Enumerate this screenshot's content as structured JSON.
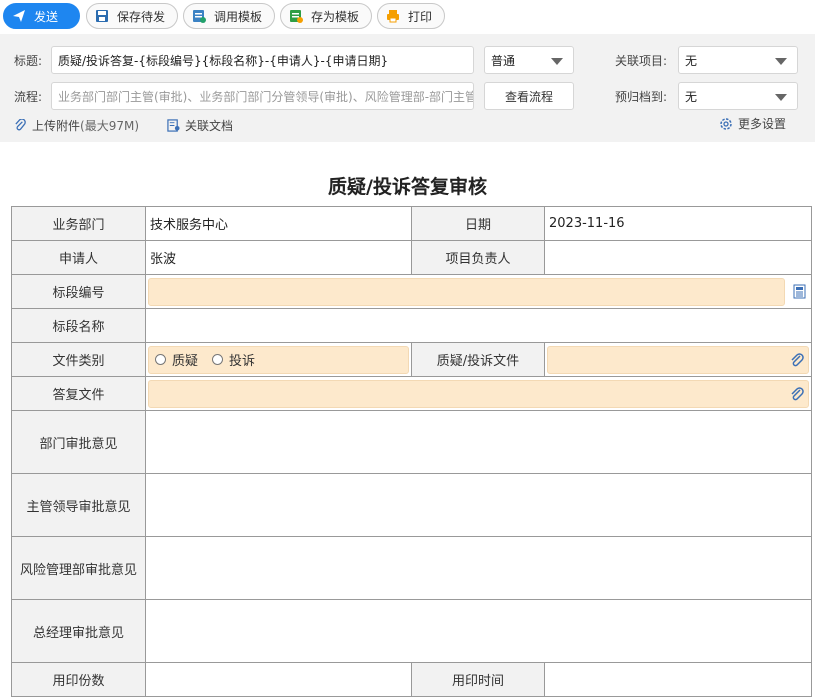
{
  "toolbar": {
    "send_label": "发送",
    "save_label": "保存待发",
    "template_label": "调用模板",
    "save_template_label": "存为模板",
    "print_label": "打印"
  },
  "header": {
    "title_label": "标题:",
    "title_value": "质疑/投诉答复-{标段编号}{标段名称}-{申请人}-{申请日期}",
    "priority_value": "普通",
    "related_project_label": "关联项目:",
    "related_project_value": "无",
    "flow_label": "流程:",
    "flow_value": "业务部门部门主管(审批)、业务部门部门分管领导(审批)、风险管理部-部门主管",
    "view_flow_label": "查看流程",
    "archive_label": "预归档到:",
    "archive_value": "无",
    "upload_label": "上传附件",
    "upload_limit": "(最大97M)",
    "related_doc_label": "关联文档",
    "more_settings_label": "更多设置"
  },
  "form": {
    "title": "质疑/投诉答复审核",
    "dept_label": "业务部门",
    "dept_value": "技术服务中心",
    "date_label": "日期",
    "date_value": "2023-11-16",
    "applicant_label": "申请人",
    "applicant_value": "张波",
    "project_lead_label": "项目负责人",
    "project_lead_value": "",
    "section_no_label": "标段编号",
    "section_name_label": "标段名称",
    "file_type_label": "文件类别",
    "file_type_options": [
      "质疑",
      "投诉"
    ],
    "query_file_label": "质疑/投诉文件",
    "reply_file_label": "答复文件",
    "dept_opinion_label": "部门审批意见",
    "leader_opinion_label": "主管领导审批意见",
    "risk_opinion_label": "风险管理部审批意见",
    "gm_opinion_label": "总经理审批意见",
    "seal_count_label": "用印份数",
    "seal_time_label": "用印时间"
  },
  "colors": {
    "accent": "#1e86f0",
    "field_fill": "#fde9cc",
    "label_bg": "#f2f2f2"
  }
}
